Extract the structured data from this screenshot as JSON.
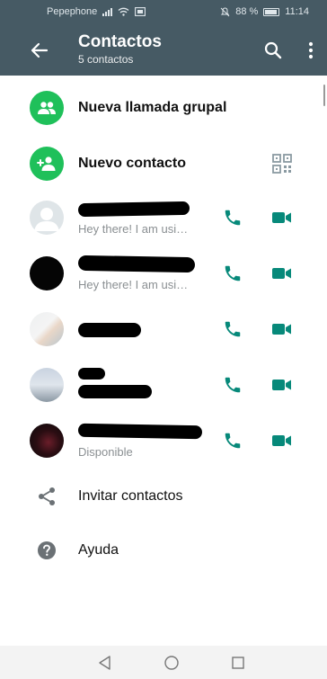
{
  "status": {
    "carrier": "Pepephone",
    "battery": "88 %",
    "time": "11:14"
  },
  "header": {
    "title": "Contactos",
    "subtitle": "5 contactos"
  },
  "actions": [
    {
      "label": "Nueva llamada grupal",
      "icon": "group-icon"
    },
    {
      "label": "Nuevo contacto",
      "icon": "add-person-icon"
    }
  ],
  "contacts": [
    {
      "status": "Hey there! I am usi…"
    },
    {
      "status": "Hey there! I am usi…"
    },
    {
      "status": ""
    },
    {
      "status": ""
    },
    {
      "status": "Disponible"
    }
  ],
  "footer": {
    "invite": "Invitar contactos",
    "help": "Ayuda"
  },
  "colors": {
    "toolbar": "#465a64",
    "accent": "#1fc05a",
    "icon_teal": "#07897a"
  }
}
